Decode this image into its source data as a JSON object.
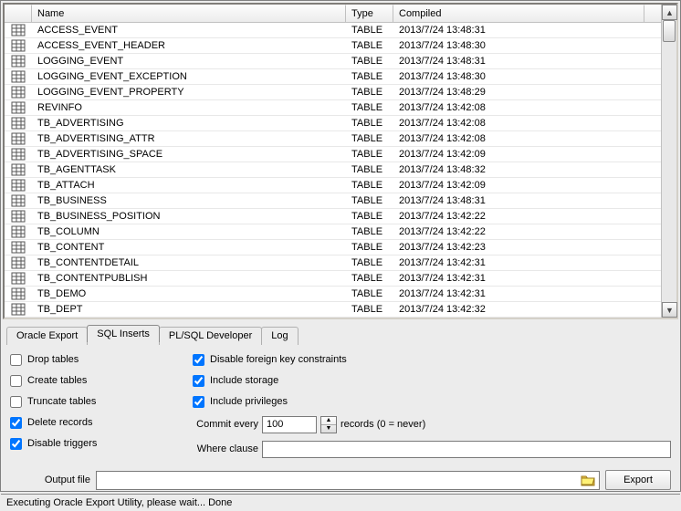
{
  "columns": {
    "name": "Name",
    "type": "Type",
    "compiled": "Compiled"
  },
  "rows": [
    {
      "name": "ACCESS_EVENT",
      "type": "TABLE",
      "compiled": "2013/7/24 13:48:31"
    },
    {
      "name": "ACCESS_EVENT_HEADER",
      "type": "TABLE",
      "compiled": "2013/7/24 13:48:30"
    },
    {
      "name": "LOGGING_EVENT",
      "type": "TABLE",
      "compiled": "2013/7/24 13:48:31"
    },
    {
      "name": "LOGGING_EVENT_EXCEPTION",
      "type": "TABLE",
      "compiled": "2013/7/24 13:48:30"
    },
    {
      "name": "LOGGING_EVENT_PROPERTY",
      "type": "TABLE",
      "compiled": "2013/7/24 13:48:29"
    },
    {
      "name": "REVINFO",
      "type": "TABLE",
      "compiled": "2013/7/24 13:42:08"
    },
    {
      "name": "TB_ADVERTISING",
      "type": "TABLE",
      "compiled": "2013/7/24 13:42:08"
    },
    {
      "name": "TB_ADVERTISING_ATTR",
      "type": "TABLE",
      "compiled": "2013/7/24 13:42:08"
    },
    {
      "name": "TB_ADVERTISING_SPACE",
      "type": "TABLE",
      "compiled": "2013/7/24 13:42:09"
    },
    {
      "name": "TB_AGENTTASK",
      "type": "TABLE",
      "compiled": "2013/7/24 13:48:32"
    },
    {
      "name": "TB_ATTACH",
      "type": "TABLE",
      "compiled": "2013/7/24 13:42:09"
    },
    {
      "name": "TB_BUSINESS",
      "type": "TABLE",
      "compiled": "2013/7/24 13:48:31"
    },
    {
      "name": "TB_BUSINESS_POSITION",
      "type": "TABLE",
      "compiled": "2013/7/24 13:42:22"
    },
    {
      "name": "TB_COLUMN",
      "type": "TABLE",
      "compiled": "2013/7/24 13:42:22"
    },
    {
      "name": "TB_CONTENT",
      "type": "TABLE",
      "compiled": "2013/7/24 13:42:23"
    },
    {
      "name": "TB_CONTENTDETAIL",
      "type": "TABLE",
      "compiled": "2013/7/24 13:42:31"
    },
    {
      "name": "TB_CONTENTPUBLISH",
      "type": "TABLE",
      "compiled": "2013/7/24 13:42:31"
    },
    {
      "name": "TB_DEMO",
      "type": "TABLE",
      "compiled": "2013/7/24 13:42:31"
    },
    {
      "name": "TB_DEPT",
      "type": "TABLE",
      "compiled": "2013/7/24 13:42:32"
    }
  ],
  "tabs": {
    "oracle_export": "Oracle Export",
    "sql_inserts": "SQL Inserts",
    "plsql_dev": "PL/SQL Developer",
    "log": "Log"
  },
  "options": {
    "drop_tables": "Drop tables",
    "create_tables": "Create tables",
    "truncate_tables": "Truncate tables",
    "delete_records": "Delete records",
    "disable_triggers": "Disable triggers",
    "disable_fk": "Disable foreign key constraints",
    "include_storage": "Include storage",
    "include_privileges": "Include privileges",
    "commit_every_label": "Commit every",
    "commit_every_value": "100",
    "commit_suffix": "records (0 = never)",
    "where_clause_label": "Where clause",
    "where_clause_value": ""
  },
  "output": {
    "label": "Output file",
    "value": "",
    "export_btn": "Export"
  },
  "status": "Executing Oracle Export Utility, please wait...   Done"
}
